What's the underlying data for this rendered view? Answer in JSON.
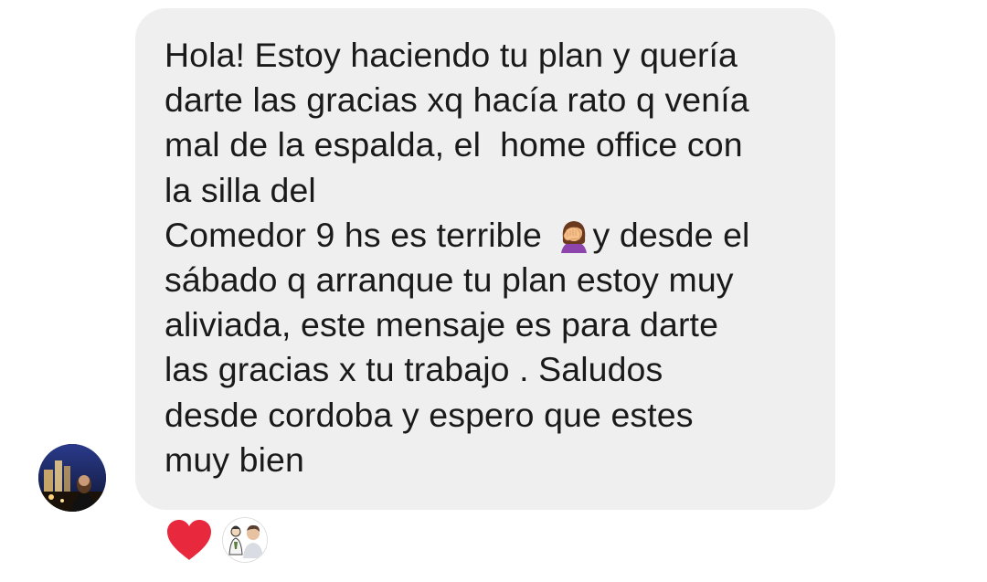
{
  "message": {
    "lines": [
      "Hola! Estoy haciendo tu plan y quería",
      "darte las gracias xq hacía rato q venía",
      "mal de la espalda, el  home office con",
      "la silla del",
      "Comedor 9 hs es terrible ",
      "y desde el",
      "sábado q arranque tu plan estoy muy",
      "aliviada, este mensaje es para darte",
      "las gracias x tu trabajo . Saludos",
      "desde cordoba y espero que estes",
      "muy bien"
    ],
    "inline_icon": "woman-facepalming-icon",
    "bubble_color": "#efefef",
    "text_color": "#1a1a1a"
  },
  "sender": {
    "avatar_icon": "sender-avatar"
  },
  "reactions": {
    "icon": "heart-icon",
    "color": "#e8283c",
    "reactor_avatar_icon": "reactor-avatar"
  }
}
